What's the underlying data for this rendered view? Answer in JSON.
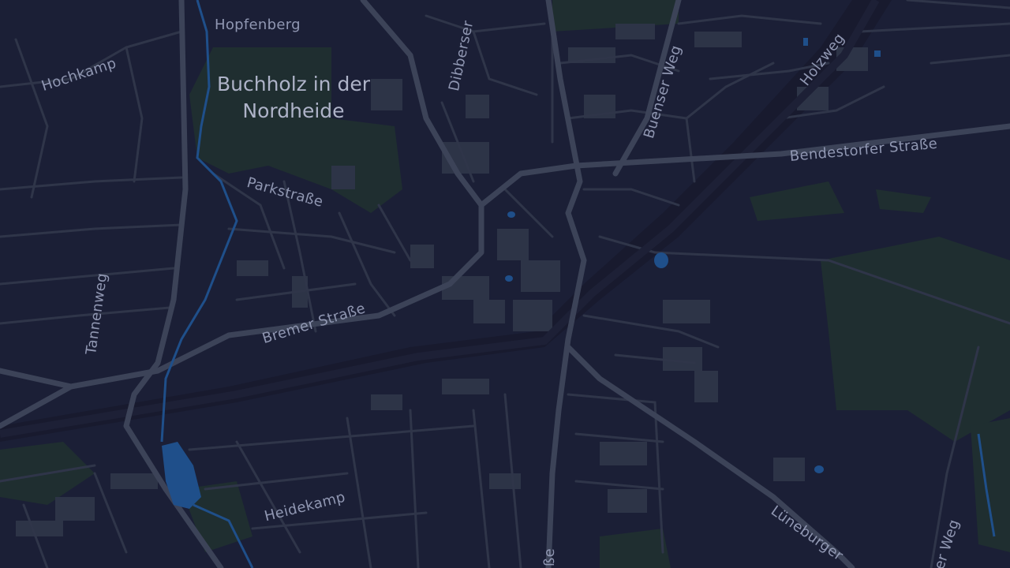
{
  "map": {
    "theme": "dark",
    "colors": {
      "background": "#1b1f36",
      "forest": "#1f2e30",
      "water": "#1f4f8a",
      "major_road": "#3c4358",
      "minor_road": "#2f3549",
      "building": "#2d3447",
      "railway": "#181a2e",
      "label": "#9097b2"
    },
    "city_label_line1": "Buchholz in der",
    "city_label_line2": "Nordheide",
    "labels": {
      "hopfenberg": "Hopfenberg",
      "hochkamp": "Hochkamp",
      "dibbersen": "Dibberser",
      "buenser_weg": "Buenser Weg",
      "holzweg": "Holzweg",
      "bendestorfer": "Bendestorfer Straße",
      "parkstrasse": "Parkstraße",
      "tannenweg": "Tannenweg",
      "bremer": "Bremer Straße",
      "heidekamp": "Heidekamp",
      "lueneburger": "Lüneburger",
      "weg_se": "er Weg",
      "strasse_s": "ße"
    }
  }
}
